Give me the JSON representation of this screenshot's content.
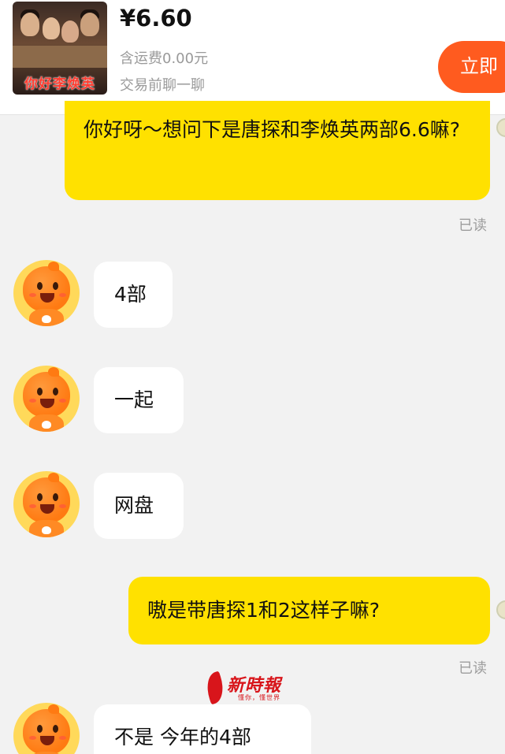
{
  "product": {
    "poster_title": "你好李焕英",
    "price": "¥6.60",
    "shipping": "含运费0.00元",
    "chat_hint": "交易前聊一聊",
    "buy_label": "立即"
  },
  "messages": [
    {
      "side": "out",
      "text": "你好呀～想问下是唐探和李焕英两部6.6嘛?",
      "status": "已读"
    },
    {
      "side": "in",
      "text": "4部"
    },
    {
      "side": "in",
      "text": "一起"
    },
    {
      "side": "in",
      "text": "网盘"
    },
    {
      "side": "out",
      "text": "嗷是带唐探1和2这样子嘛?",
      "status": "已读"
    },
    {
      "side": "in",
      "text": "不是 今年的4部"
    }
  ],
  "watermark": {
    "title": "新時報",
    "subtitle": "懂你，懂世界"
  },
  "colors": {
    "outgoing_bubble": "#ffe100",
    "incoming_bubble": "#ffffff",
    "buy_button": "#ff5b1f",
    "background": "#f2f2f2"
  }
}
